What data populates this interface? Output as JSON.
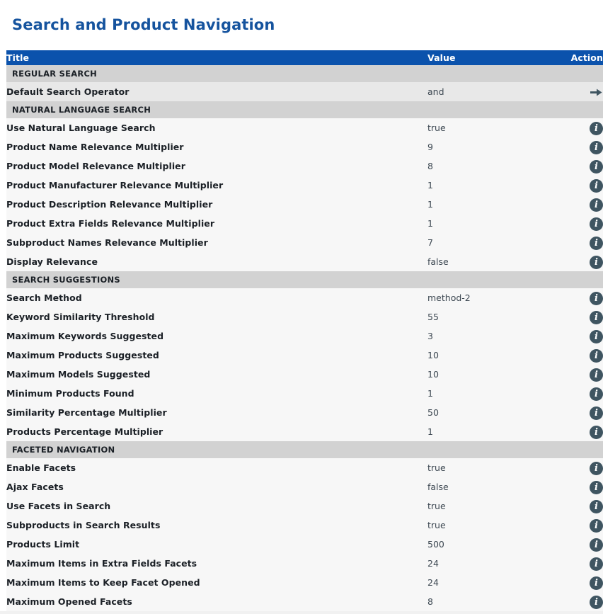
{
  "page": {
    "title": "Search and Product Navigation",
    "title_color": "#15539e",
    "header_bg": "#0b52ac",
    "section_bg": "#d2d2d2",
    "row_bg_dark": "#e8e8e8",
    "row_bg_light": "#f7f7f7",
    "icon_color": "#3f5561"
  },
  "table": {
    "columns": {
      "title": "Title",
      "value": "Value",
      "action": "Action"
    },
    "sections": [
      {
        "label": "REGULAR SEARCH",
        "rows": [
          {
            "title": "Default Search Operator",
            "value": "and",
            "action_icon": "arrow-right-icon",
            "shade": "dark"
          }
        ]
      },
      {
        "label": "NATURAL LANGUAGE SEARCH",
        "rows": [
          {
            "title": "Use Natural Language Search",
            "value": "true",
            "action_icon": "info-icon",
            "shade": "light"
          },
          {
            "title": "Product Name Relevance Multiplier",
            "value": "9",
            "action_icon": "info-icon",
            "shade": "light"
          },
          {
            "title": "Product Model Relevance Multiplier",
            "value": "8",
            "action_icon": "info-icon",
            "shade": "light"
          },
          {
            "title": "Product Manufacturer Relevance Multiplier",
            "value": "1",
            "action_icon": "info-icon",
            "shade": "light"
          },
          {
            "title": "Product Description Relevance Multiplier",
            "value": "1",
            "action_icon": "info-icon",
            "shade": "light"
          },
          {
            "title": "Product Extra Fields Relevance Multiplier",
            "value": "1",
            "action_icon": "info-icon",
            "shade": "light"
          },
          {
            "title": "Subproduct Names Relevance Multiplier",
            "value": "7",
            "action_icon": "info-icon",
            "shade": "light"
          },
          {
            "title": "Display Relevance",
            "value": "false",
            "action_icon": "info-icon",
            "shade": "light"
          }
        ]
      },
      {
        "label": "SEARCH SUGGESTIONS",
        "rows": [
          {
            "title": "Search Method",
            "value": "method-2",
            "action_icon": "info-icon",
            "shade": "light"
          },
          {
            "title": "Keyword Similarity Threshold",
            "value": "55",
            "action_icon": "info-icon",
            "shade": "light"
          },
          {
            "title": "Maximum Keywords Suggested",
            "value": "3",
            "action_icon": "info-icon",
            "shade": "light"
          },
          {
            "title": "Maximum Products Suggested",
            "value": "10",
            "action_icon": "info-icon",
            "shade": "light"
          },
          {
            "title": "Maximum Models Suggested",
            "value": "10",
            "action_icon": "info-icon",
            "shade": "light"
          },
          {
            "title": "Minimum Products Found",
            "value": "1",
            "action_icon": "info-icon",
            "shade": "light"
          },
          {
            "title": "Similarity Percentage Multiplier",
            "value": "50",
            "action_icon": "info-icon",
            "shade": "light"
          },
          {
            "title": "Products Percentage Multiplier",
            "value": "1",
            "action_icon": "info-icon",
            "shade": "light"
          }
        ]
      },
      {
        "label": "FACETED NAVIGATION",
        "value_column": "narrow",
        "rows": [
          {
            "title": "Enable Facets",
            "value": "true",
            "action_icon": "info-icon",
            "shade": "light"
          },
          {
            "title": "Ajax Facets",
            "value": "false",
            "action_icon": "info-icon",
            "shade": "light"
          },
          {
            "title": "Use Facets in Search",
            "value": "true",
            "action_icon": "info-icon",
            "shade": "light"
          },
          {
            "title": "Subproducts in Search Results",
            "value": "true",
            "action_icon": "info-icon",
            "shade": "light"
          },
          {
            "title": "Products Limit",
            "value": "500",
            "action_icon": "info-icon",
            "shade": "light"
          },
          {
            "title": "Maximum Items in Extra Fields Facets",
            "value": "24",
            "action_icon": "info-icon",
            "shade": "light"
          },
          {
            "title": "Maximum Items to Keep Facet Opened",
            "value": "24",
            "action_icon": "info-icon",
            "shade": "light"
          },
          {
            "title": "Maximum Opened Facets",
            "value": "8",
            "action_icon": "info-icon",
            "shade": "light"
          }
        ]
      }
    ]
  },
  "icons": {
    "info_glyph": "i"
  }
}
